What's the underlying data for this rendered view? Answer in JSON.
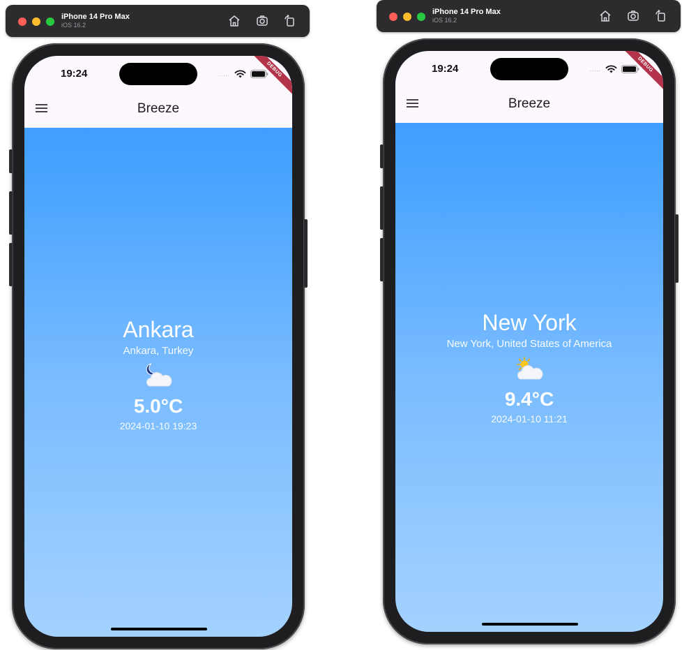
{
  "simulators": [
    {
      "titlebar": {
        "device": "iPhone 14 Pro Max",
        "os": "iOS 16.2"
      },
      "status": {
        "time": "19:24",
        "signal": "....."
      },
      "debug": "DEBUG",
      "appbar": {
        "title": "Breeze"
      },
      "weather": {
        "city": "Ankara",
        "region": "Ankara, Turkey",
        "condition_icon": "moon-cloud-icon",
        "temperature": "5.0°C",
        "datetime": "2024-01-10 19:23"
      }
    },
    {
      "titlebar": {
        "device": "iPhone 14 Pro Max",
        "os": "iOS 16.2"
      },
      "status": {
        "time": "19:24",
        "signal": "....."
      },
      "debug": "DEBUG",
      "appbar": {
        "title": "Breeze"
      },
      "weather": {
        "city": "New York",
        "region": "New York, United States of America",
        "condition_icon": "sun-cloud-icon",
        "temperature": "9.4°C",
        "datetime": "2024-01-10 11:21"
      }
    }
  ],
  "colors": {
    "gradient_top": "#3197ff",
    "gradient_bottom": "#a4d2ff",
    "appbar_bg": "#fdf7fe",
    "debug_ribbon": "#b3334a"
  }
}
